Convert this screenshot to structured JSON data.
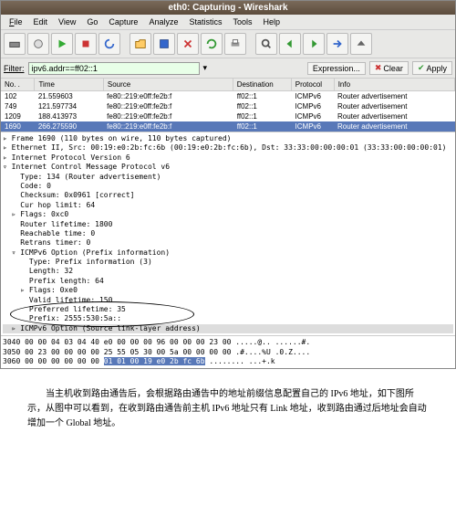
{
  "title": "eth0: Capturing - Wireshark",
  "menu": {
    "file": "File",
    "edit": "Edit",
    "view": "View",
    "go": "Go",
    "capture": "Capture",
    "analyze": "Analyze",
    "statistics": "Statistics",
    "tools": "Tools",
    "help": "Help"
  },
  "filter": {
    "label": "Filter:",
    "value": "ipv6.addr==ff02::1",
    "expr": "Expression...",
    "clear": "Clear",
    "apply": "Apply"
  },
  "cols": {
    "no": "No. .",
    "time": "Time",
    "src": "Source",
    "dst": "Destination",
    "proto": "Protocol",
    "info": "Info"
  },
  "rows": [
    {
      "no": "102",
      "time": "21.559603",
      "src": "fe80::219:e0ff:fe2b:f",
      "dst": "ff02::1",
      "proto": "ICMPv6",
      "info": "Router advertisement"
    },
    {
      "no": "749",
      "time": "121.597734",
      "src": "fe80::219:e0ff:fe2b:f",
      "dst": "ff02::1",
      "proto": "ICMPv6",
      "info": "Router advertisement"
    },
    {
      "no": "1209",
      "time": "188.413973",
      "src": "fe80::219:e0ff:fe2b:f",
      "dst": "ff02::1",
      "proto": "ICMPv6",
      "info": "Router advertisement"
    },
    {
      "no": "1690",
      "time": "266.275590",
      "src": "fe80::219:e0ff:fe2b:f",
      "dst": "ff02::1",
      "proto": "ICMPv6",
      "info": "Router advertisement"
    }
  ],
  "details": {
    "l0": "▹ Frame 1690 (110 bytes on wire, 110 bytes captured)",
    "l1": "▹ Ethernet II, Src: 00:19:e0:2b:fc:6b (00:19:e0:2b:fc:6b), Dst: 33:33:00:00:00:01 (33:33:00:00:00:01)",
    "l2": "▹ Internet Protocol Version 6",
    "l3": "▿ Internet Control Message Protocol v6",
    "l4": "    Type: 134 (Router advertisement)",
    "l5": "    Code: 0",
    "l6": "    Checksum: 0x0961 [correct]",
    "l7": "    Cur hop limit: 64",
    "l8": "  ▹ Flags: 0xc0",
    "l9": "    Router lifetime: 1800",
    "l10": "    Reachable time: 0",
    "l11": "    Retrans timer: 0",
    "l12": "  ▿ ICMPv6 Option (Prefix information)",
    "l13": "      Type: Prefix information (3)",
    "l14": "      Length: 32",
    "l15": "      Prefix length: 64",
    "l16": "    ▹ Flags: 0xe0",
    "l17": "      Valid lifetime: 150",
    "l18": "      Preferred lifetime: 35",
    "l19": "      Prefix: 2555:530:5a::",
    "l20": "  ▹ ICMPv6 Option (Source link-layer address)"
  },
  "hex": {
    "r1a": "3040  00 00 04 03 04 40 e0 00  00 00 96 00 00 00 23 00   .....@.. ......#.",
    "r2a": "3050  00 23 00 00 00 00 25 55  05 30 00 5a 00 00 00 00   .#....%U .0.Z....",
    "r3a": "3060  00 00 00 00 00 00 ",
    "r3b": "01 01  00 19 e0 2b fc 6b",
    "r3c": "        ........ ...+.k"
  },
  "caption": "当主机收到路由通告后，会根据路由通告中的地址前缀信息配置自己的 IPv6 地址，如下图所示，从图中可以看到，在收到路由通告前主机 IPv6 地址只有 Link 地址，收到路由通过后地址会自动增加一个 Global 地址。"
}
